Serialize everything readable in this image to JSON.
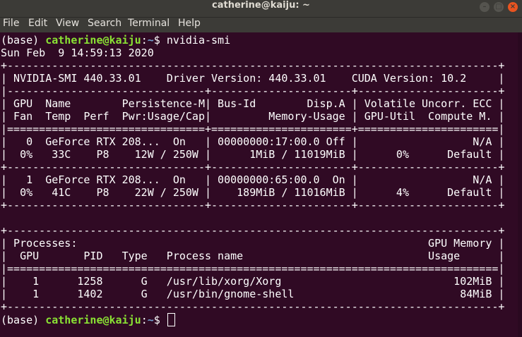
{
  "window": {
    "title": "catherine@kaiju: ~"
  },
  "menu": [
    "File",
    "Edit",
    "View",
    "Search",
    "Terminal",
    "Help"
  ],
  "prompt": {
    "env": "(base)",
    "userhost": "catherine@kaiju",
    "sep": ":",
    "path": "~",
    "symbol": "$"
  },
  "command": "nvidia-smi",
  "output": [
    "Sun Feb  9 14:59:13 2020",
    "+-----------------------------------------------------------------------------+",
    "| NVIDIA-SMI 440.33.01    Driver Version: 440.33.01    CUDA Version: 10.2     |",
    "|-------------------------------+----------------------+----------------------+",
    "| GPU  Name        Persistence-M| Bus-Id        Disp.A | Volatile Uncorr. ECC |",
    "| Fan  Temp  Perf  Pwr:Usage/Cap|         Memory-Usage | GPU-Util  Compute M. |",
    "|===============================+======================+======================|",
    "|   0  GeForce RTX 208...  On   | 00000000:17:00.0 Off |                  N/A |",
    "|  0%   33C    P8    12W / 250W |      1MiB / 11019MiB |      0%      Default |",
    "+-------------------------------+----------------------+----------------------+",
    "|   1  GeForce RTX 208...  On   | 00000000:65:00.0  On |                  N/A |",
    "|  0%   41C    P8    22W / 250W |    189MiB / 11016MiB |      4%      Default |",
    "+-------------------------------+----------------------+----------------------+",
    "",
    "+-----------------------------------------------------------------------------+",
    "| Processes:                                                       GPU Memory |",
    "|  GPU       PID   Type   Process name                             Usage      |",
    "|=============================================================================|",
    "|    1      1258      G   /usr/lib/xorg/Xorg                           102MiB |",
    "|    1      1402      G   /usr/bin/gnome-shell                          84MiB |",
    "+-----------------------------------------------------------------------------+"
  ],
  "colors": {
    "background": "#300a24",
    "prompt_user": "#8ae234",
    "prompt_path": "#729fcf"
  }
}
